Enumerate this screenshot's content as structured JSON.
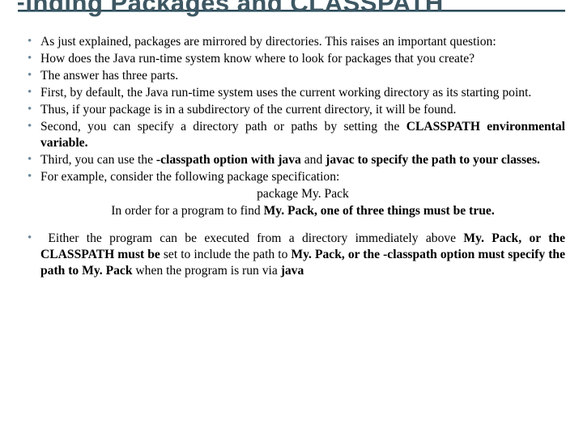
{
  "title": "Finding Packages and CLASSPATH",
  "bullets": [
    {
      "html": "As just explained, packages are mirrored by directories. This raises an important question:"
    },
    {
      "html": "How does the Java run-time system know where to look for packages that you create?"
    },
    {
      "html": "The answer has three parts."
    },
    {
      "html": "First, by default, the Java run-time system uses the current working directory as its starting point."
    },
    {
      "html": "Thus, if your package is in a subdirectory of the current directory, it will be found."
    },
    {
      "html": "Second, you can specify a directory path or paths by setting the <span class=\"bold\">CLASSPATH environmental variable.</span>"
    },
    {
      "html": "Third, you can use the <span class=\"bold\">-classpath option with java</span> and <span class=\"bold\">javac to specify the path to your classes.</span>"
    },
    {
      "html": "For example, consider the following package specification:"
    }
  ],
  "example_line": "package My. Pack",
  "example_followup": "In order for a program to find <span class=\"bold\">My. Pack, one of three things must be true.</span>",
  "final_bullet": "<span class=\"leadspace\"></span>Either the program can be executed from a directory immediately above <span class=\"bold\">My. Pack, or the CLASSPATH must be</span> set to include the path to <span class=\"bold\">My. Pack, or the -classpath option must specify the path to My. Pack</span> when the program is run via <span class=\"bold\">java</span>"
}
